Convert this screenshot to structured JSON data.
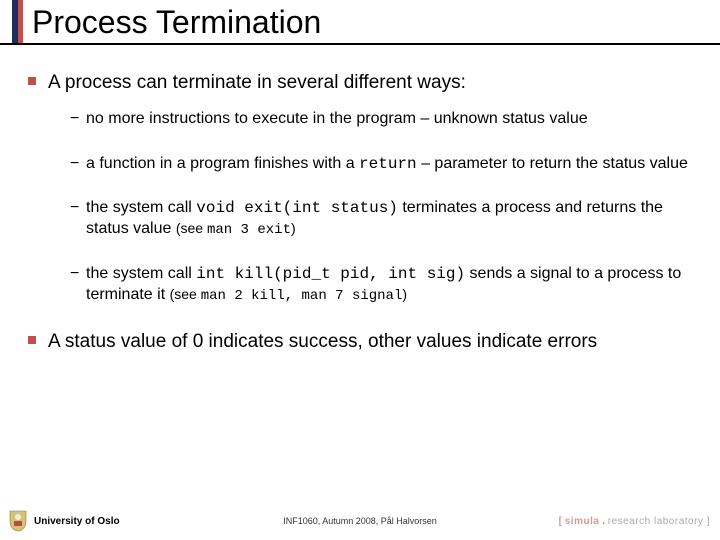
{
  "title": "Process Termination",
  "bullets": {
    "b1": "A process can terminate in several different ways:",
    "s1": "no more instructions to execute in the program – unknown status value",
    "s2a": "a function in a program finishes with a ",
    "s2code": "return",
    "s2b": " – parameter to return the status value",
    "s3a": "the system call ",
    "s3code": "void exit(int status)",
    "s3b": " terminates a process and returns the status value  ",
    "s3see_open": "(see ",
    "s3see_code": "man 3 exit",
    "s3see_close": ")",
    "s4a": "the system call ",
    "s4code": "int kill(pid_t pid, int sig)",
    "s4b": " sends a signal to a process to terminate it ",
    "s4see_open": "(see ",
    "s4see_code": "man 2 kill, man 7 signal",
    "s4see_close": ")",
    "b2": "A status value of 0 indicates success, other values indicate errors"
  },
  "footer": {
    "uio": "University of Oslo",
    "course": "INF1060, Autumn 2008, Pål Halvorsen",
    "simula_bracket_open": "[ ",
    "simula_word": "simula",
    "simula_dot": " . ",
    "simula_rest": "research laboratory ]"
  }
}
